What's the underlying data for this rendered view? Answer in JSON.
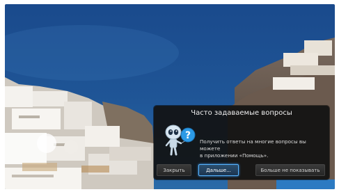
{
  "dialog": {
    "title": "Часто задаваемые вопросы",
    "message_line1": "Получить ответы на многие вопросы вы можете",
    "message_line2": "в приложении «Помощь».",
    "buttons": {
      "close": "Закрыть",
      "next": "Дальше...",
      "never_show": "Больше не показывать"
    }
  },
  "colors": {
    "sea": "#1e4f8f",
    "dialog_bg": "#121212",
    "focus_accent": "#58b4ff"
  }
}
